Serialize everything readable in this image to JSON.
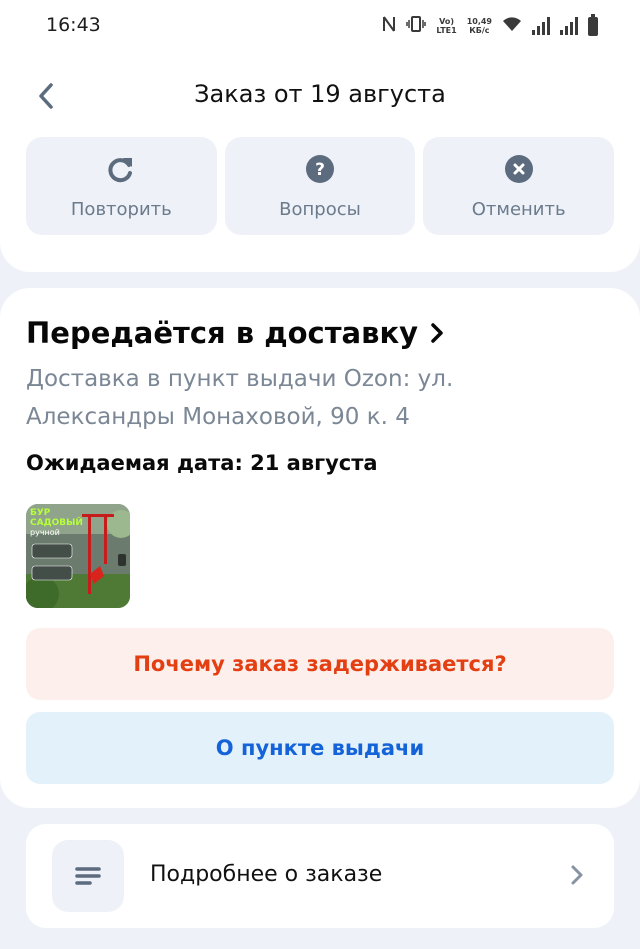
{
  "status_bar": {
    "time": "16:43",
    "lte_label_top": "Vo)",
    "lte_label_bottom": "LTE1",
    "speed_top": "10,49",
    "speed_bottom": "КБ/с"
  },
  "header": {
    "title": "Заказ от 19 августа"
  },
  "actions": [
    {
      "label": "Повторить",
      "icon": "repeat-icon"
    },
    {
      "label": "Вопросы",
      "icon": "question-icon"
    },
    {
      "label": "Отменить",
      "icon": "cancel-icon"
    }
  ],
  "order": {
    "status": "Передаётся в доставку",
    "address": "Доставка в пункт выдачи Ozon: ул. Александры Монаховой, 90 к. 4",
    "expected_date": "Ожидаемая дата: 21 августа",
    "product_image_text": [
      "БУР",
      "САДОВЫЙ",
      "ручной"
    ]
  },
  "buttons": {
    "delay": "Почему заказ задерживается?",
    "pickup": "О пункте выдачи"
  },
  "details": {
    "label": "Подробнее о заказе"
  },
  "colors": {
    "accent_red": "#e33f12",
    "accent_blue": "#1463d8",
    "icon_gray": "#5c6b7d",
    "background": "#eef2f8"
  }
}
